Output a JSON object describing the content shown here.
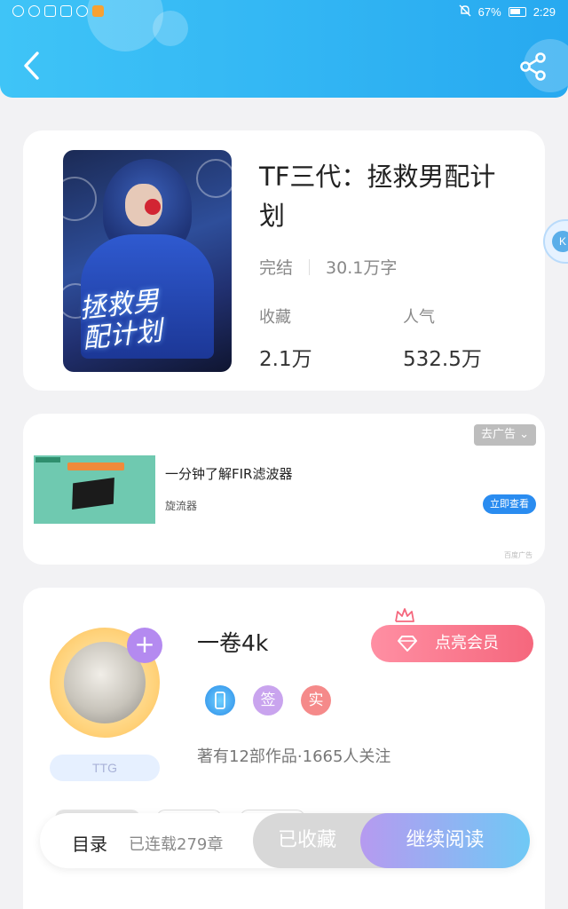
{
  "status_bar": {
    "battery": "67%",
    "time": "2:29"
  },
  "book": {
    "title": "TF三代：拯救男配计划",
    "status": "完结",
    "word_count": "30.1万字",
    "favorites_label": "收藏",
    "favorites_value": "2.1万",
    "popularity_label": "人气",
    "popularity_value": "532.5万"
  },
  "ad": {
    "close_label": "去广告",
    "title": "一分钟了解FIR滤波器",
    "source": "旋流器",
    "cta": "立即查看",
    "mark": "百度广告"
  },
  "author": {
    "name": "一卷4k",
    "tag": "TTG",
    "vip_button": "点亮会员",
    "badge_sign": "签",
    "badge_real": "实",
    "info": "著有12部作品·1665人关注"
  },
  "bottom_bar": {
    "toc_label": "目录",
    "chapter_count": "已连载279章",
    "favorited_button": "已收藏",
    "read_button": "继续阅读"
  },
  "colors": {
    "header": "#27a9f0",
    "read_button": "#6fc9f5",
    "vip": "#f5677d"
  }
}
